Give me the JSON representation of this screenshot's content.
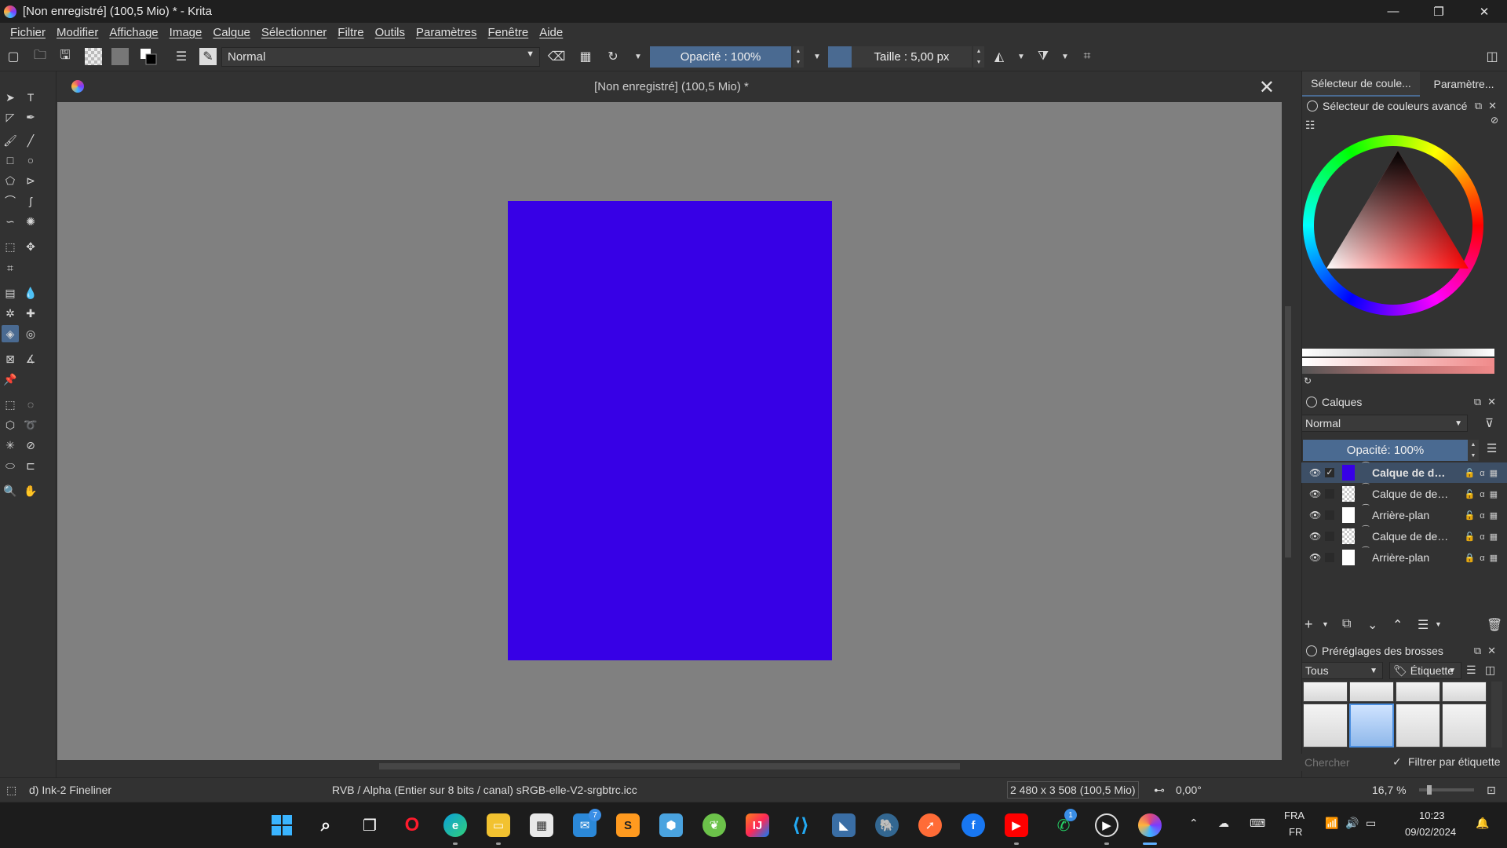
{
  "window": {
    "title": "[Non enregistré]  (100,5 Mio) * - Krita",
    "minimize_glyph": "—",
    "maximize_glyph": "❐",
    "close_glyph": "✕"
  },
  "menu": [
    "Fichier",
    "Modifier",
    "Affichage",
    "Image",
    "Calque",
    "Sélectionner",
    "Filtre",
    "Outils",
    "Paramètres",
    "Fenêtre",
    "Aide"
  ],
  "toolbar": {
    "blend_mode": "Normal",
    "opacity_label": "Opacité : 100%",
    "size_label": "Taille : 5,00 px"
  },
  "document": {
    "tab_title": "[Non enregistré]  (100,5 Mio) *",
    "close_glyph": "✕",
    "fill_color": "#3700e6"
  },
  "panels": {
    "tabs": [
      "Sélecteur de coule...",
      "Paramètre..."
    ],
    "color_selector_title": "Sélecteur de couleurs avancé",
    "layers_title": "Calques",
    "layers_blend": "Normal",
    "layers_opacity": "Opacité:  100%",
    "layers": [
      {
        "name": "Calque de des...",
        "selected": true,
        "visible": true,
        "locked": false
      },
      {
        "name": "Calque de dessi...",
        "selected": false,
        "visible": true,
        "locked": false
      },
      {
        "name": "Arrière-plan",
        "selected": false,
        "visible": true,
        "locked": false
      },
      {
        "name": "Calque de dessi...",
        "selected": false,
        "visible": true,
        "locked": false
      },
      {
        "name": "Arrière-plan",
        "selected": false,
        "visible": true,
        "locked": true
      }
    ],
    "brush_presets_title": "Préréglages des brosses",
    "brush_filter": "Tous",
    "brush_tag": "Étiquette",
    "search_placeholder": "Chercher",
    "filter_by_tag": "Filtrer par étiquette"
  },
  "status": {
    "brush_name": "d) Ink-2 Fineliner",
    "color_profile": "RVB / Alpha (Entier sur 8 bits / canal)  sRGB-elle-V2-srgbtrc.icc",
    "dimensions": "2 480 x 3 508 (100,5 Mio)",
    "rotation": "0,00°",
    "zoom": "16,7 %"
  },
  "taskbar": {
    "mail_badge": "7",
    "app_badge": "1",
    "lang_top": "FRA",
    "lang_bottom": "FR",
    "time": "10:23",
    "date": "09/02/2024"
  }
}
